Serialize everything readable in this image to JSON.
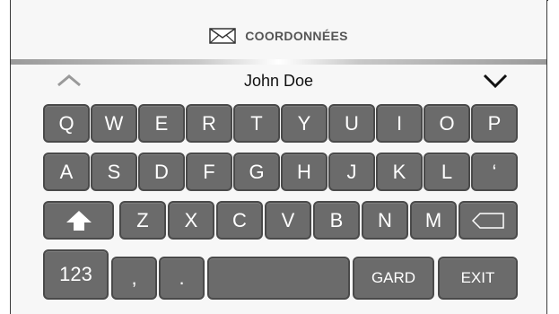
{
  "header": {
    "title": "COORDONNÉES",
    "icon": "envelope-icon"
  },
  "contact": {
    "name": "John Doe"
  },
  "nav": {
    "up_icon": "chevron-up-icon",
    "down_icon": "chevron-down-icon"
  },
  "keyboard": {
    "row1": [
      "Q",
      "W",
      "E",
      "R",
      "T",
      "Y",
      "U",
      "I",
      "O",
      "P"
    ],
    "row2": [
      "A",
      "S",
      "D",
      "F",
      "G",
      "H",
      "J",
      "K",
      "L",
      "‘"
    ],
    "row3": [
      "Z",
      "X",
      "C",
      "V",
      "B",
      "N",
      "M"
    ],
    "row4": {
      "numbers": "123",
      "comma": ",",
      "period": ".",
      "save": "GARD",
      "exit": "EXIT"
    }
  },
  "colors": {
    "key": "#6b6b6b",
    "key_border": "#4a4a4a",
    "background": "#f7f7f7"
  }
}
